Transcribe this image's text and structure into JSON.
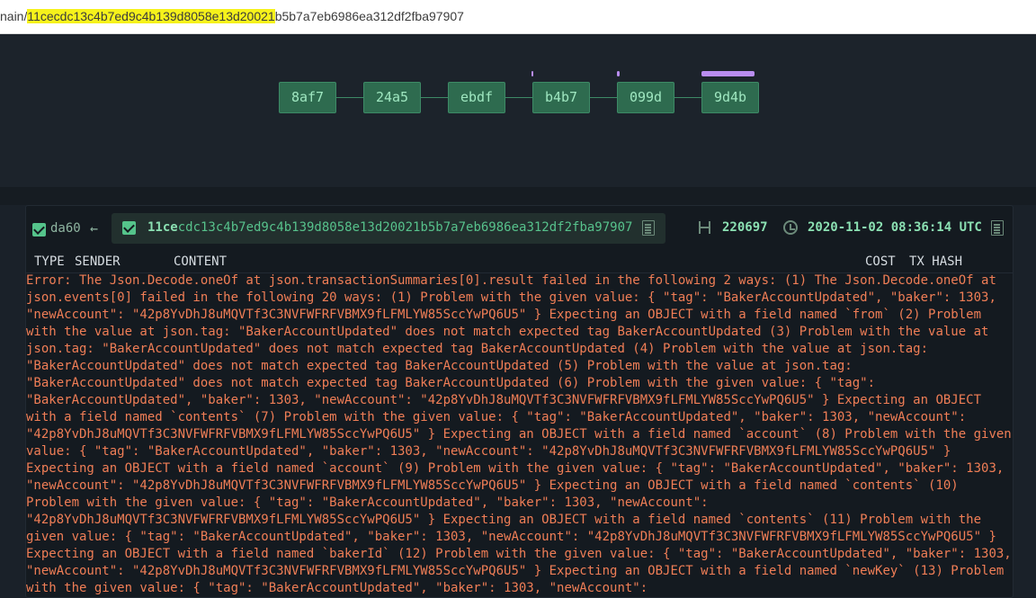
{
  "url": {
    "prefix": "nain/",
    "highlighted": "11cecdc13c4b7ed9c4b139d8058e13d20021",
    "rest": "b5b7a7eb6986ea312df2fba97907"
  },
  "chain": {
    "blocks": [
      "8af7",
      "24a5",
      "ebdf",
      "b4b7",
      "099d",
      "9d4b"
    ],
    "accent_color": "#b98df0"
  },
  "panel": {
    "parent_hash": "da60",
    "parent_arrow": "←",
    "block_hash_prefix": "11ce",
    "block_hash_rest": "cdc13c4b7ed9c4b139d8058e13d20021b5b7a7eb6986ea312df2fba97907",
    "height": "220697",
    "timestamp": "2020-11-02 08:36:14 UTC",
    "columns": {
      "type": "TYPE",
      "sender": "SENDER",
      "content": "CONTENT",
      "cost": "COST",
      "tx_hash": "TX HASH"
    },
    "error_lines": [
      "Error: The Json.Decode.oneOf at json.transactionSummaries[0].result failed in the following 2 ways: (1) The Json.Decode.oneOf at",
      "json.events[0] failed in the following 20 ways: (1) Problem with the given value: { \"tag\": \"BakerAccountUpdated\", \"baker\": 1303,",
      "\"newAccount\": \"42p8YvDhJ8uMQVTf3C3NVFWFRFVBMX9fLFMLYW85SccYwPQ6U5\" } Expecting an OBJECT with a field named `from` (2) Problem",
      "with the value at json.tag: \"BakerAccountUpdated\" does not match expected tag BakerAccountUpdated (3) Problem with the value at",
      "json.tag: \"BakerAccountUpdated\" does not match expected tag BakerAccountUpdated (4) Problem with the value at json.tag:",
      "\"BakerAccountUpdated\" does not match expected tag BakerAccountUpdated (5) Problem with the value at json.tag:",
      "\"BakerAccountUpdated\" does not match expected tag BakerAccountUpdated (6) Problem with the given value: { \"tag\":",
      "\"BakerAccountUpdated\", \"baker\": 1303, \"newAccount\": \"42p8YvDhJ8uMQVTf3C3NVFWFRFVBMX9fLFMLYW85SccYwPQ6U5\" } Expecting an OBJECT",
      "with a field named `contents` (7) Problem with the given value: { \"tag\": \"BakerAccountUpdated\", \"baker\": 1303, \"newAccount\":",
      "\"42p8YvDhJ8uMQVTf3C3NVFWFRFVBMX9fLFMLYW85SccYwPQ6U5\" } Expecting an OBJECT with a field named `account` (8) Problem with the given",
      "value: { \"tag\": \"BakerAccountUpdated\", \"baker\": 1303, \"newAccount\": \"42p8YvDhJ8uMQVTf3C3NVFWFRFVBMX9fLFMLYW85SccYwPQ6U5\" }",
      "Expecting an OBJECT with a field named `account` (9) Problem with the given value: { \"tag\": \"BakerAccountUpdated\", \"baker\": 1303,",
      "\"newAccount\": \"42p8YvDhJ8uMQVTf3C3NVFWFRFVBMX9fLFMLYW85SccYwPQ6U5\" } Expecting an OBJECT with a field named `contents` (10)",
      "Problem with the given value: { \"tag\": \"BakerAccountUpdated\", \"baker\": 1303, \"newAccount\":",
      "\"42p8YvDhJ8uMQVTf3C3NVFWFRFVBMX9fLFMLYW85SccYwPQ6U5\" } Expecting an OBJECT with a field named `contents` (11) Problem with the",
      "given value: { \"tag\": \"BakerAccountUpdated\", \"baker\": 1303, \"newAccount\": \"42p8YvDhJ8uMQVTf3C3NVFWFRFVBMX9fLFMLYW85SccYwPQ6U5\" }",
      "Expecting an OBJECT with a field named `bakerId` (12) Problem with the given value: { \"tag\": \"BakerAccountUpdated\", \"baker\": 1303,",
      "\"newAccount\": \"42p8YvDhJ8uMQVTf3C3NVFWFRFVBMX9fLFMLYW85SccYwPQ6U5\" } Expecting an OBJECT with a field named `newKey` (13) Problem",
      "with the given value: { \"tag\": \"BakerAccountUpdated\", \"baker\": 1303, \"newAccount\":"
    ]
  }
}
